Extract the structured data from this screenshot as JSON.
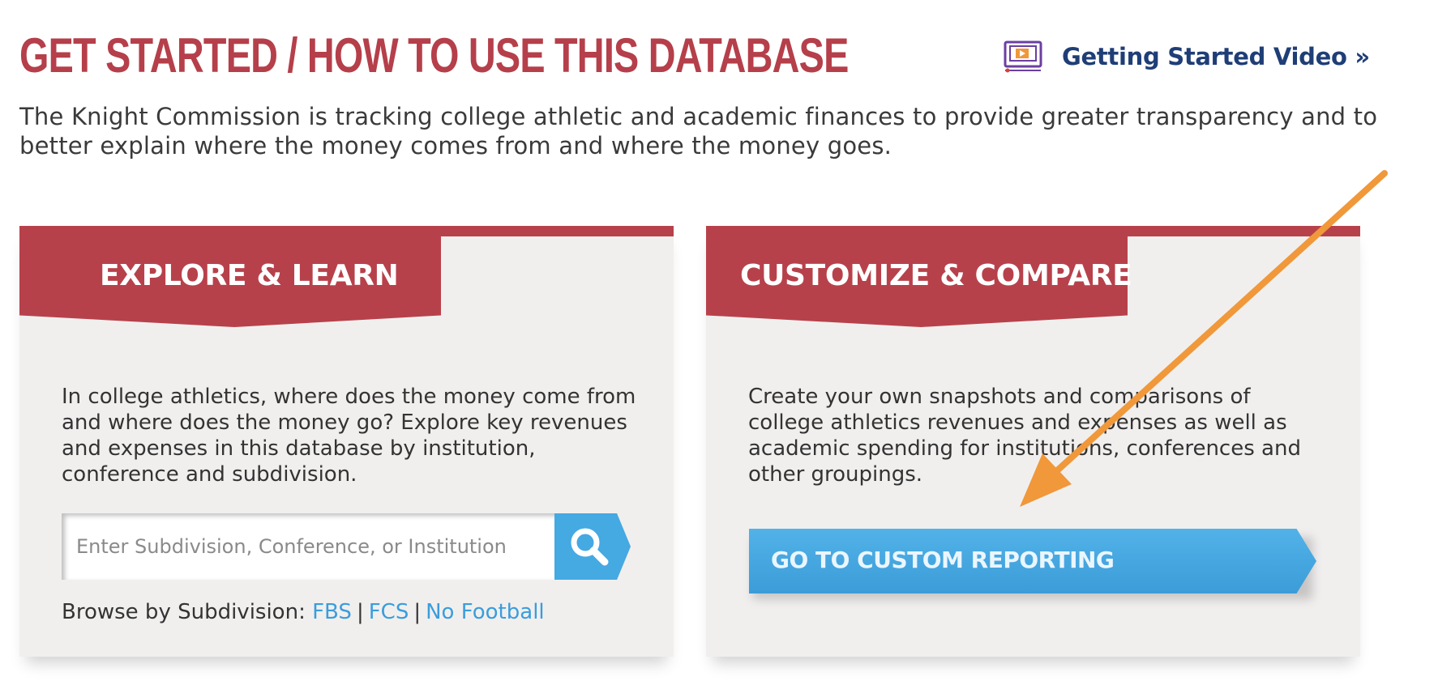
{
  "header": {
    "title": "GET STARTED / HOW TO USE THIS DATABASE",
    "video_link_label": "Getting Started Video »",
    "video_icon": "video-player-icon"
  },
  "intro": "The Knight Commission is tracking college athletic and academic finances to provide greater transparency and to better explain where the money comes from and where the money goes.",
  "explore": {
    "title": "EXPLORE & LEARN",
    "description": "In college athletics, where does the money come from and where does the money go? Explore key revenues and expenses in this database by institution, conference and subdivision.",
    "search_placeholder": "Enter Subdivision, Conference, or Institution",
    "search_icon": "search-icon",
    "browse_label": "Browse by Subdivision:",
    "browse_links": [
      "FBS",
      "FCS",
      "No Football"
    ],
    "separator": "|"
  },
  "customize": {
    "title": "CUSTOMIZE & COMPARE",
    "description": "Create your own snapshots and comparisons of college athletics revenues and expenses as well as academic spending for institutions, conferences and other groupings.",
    "button_label": "GO TO CUSTOM REPORTING"
  },
  "colors": {
    "brand_red": "#b7414b",
    "title_red": "#b53f4a",
    "link_blue": "#3a9ddc",
    "button_blue": "#45a9e2",
    "navy": "#1f3e77",
    "card_bg": "#f1efee",
    "annotation_orange": "#f0983a"
  }
}
